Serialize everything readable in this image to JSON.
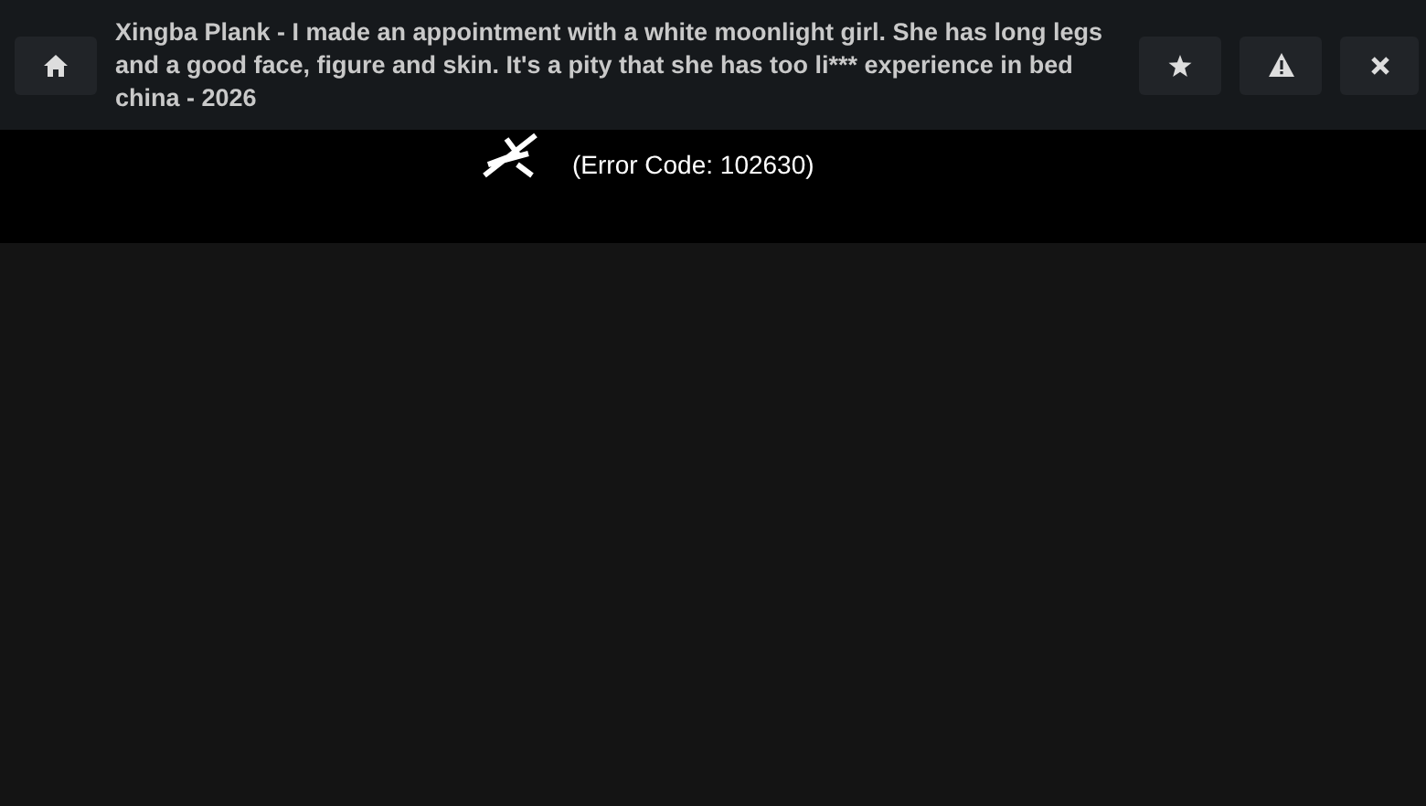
{
  "header": {
    "title": "Xingba Plank - I made an appointment with a white moonlight girl. She has long legs and a good face, figure and skin. It's a pity that she has too li*** experience in bed china - 2026"
  },
  "player": {
    "error_code": "(Error Code: 102630)"
  }
}
